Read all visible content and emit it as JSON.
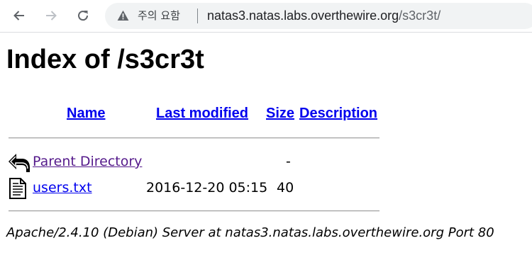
{
  "browser": {
    "security_label": "주의 요함",
    "url_host": "natas3.natas.labs.overthewire.org",
    "url_path": "/s3cr3t/",
    "icons": {
      "back": "arrow-left-icon",
      "forward": "arrow-right-icon",
      "reload": "reload-icon",
      "security": "warning-triangle-icon"
    }
  },
  "page": {
    "title": "Index of /s3cr3t",
    "columns": {
      "name": "Name",
      "last_modified": "Last modified",
      "size": "Size",
      "description": "Description"
    },
    "rows": [
      {
        "icon": "back-arrow-icon",
        "name": "Parent Directory",
        "last_modified": "",
        "size": "-",
        "description": ""
      },
      {
        "icon": "text-file-icon",
        "name": "users.txt",
        "last_modified": "2016-12-20 05:15",
        "size": "40",
        "description": ""
      }
    ],
    "server_signature": "Apache/2.4.10 (Debian) Server at natas3.natas.labs.overthewire.org Port 80"
  },
  "colors": {
    "link": "#0000ee",
    "visited_link": "#551a8b",
    "omnibox_bg": "#f1f3f4"
  }
}
